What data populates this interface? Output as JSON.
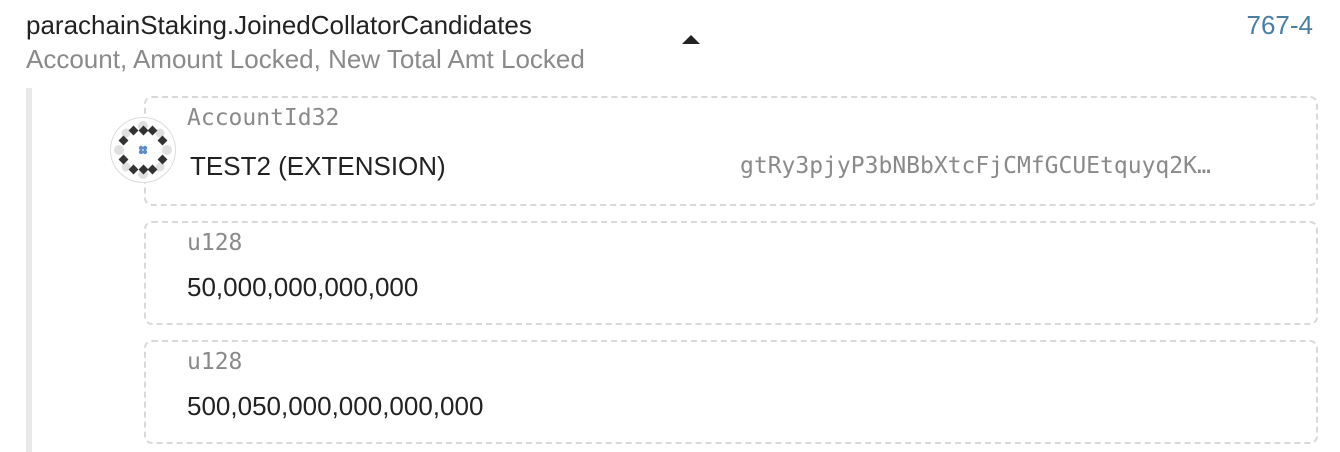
{
  "event": {
    "title": "parachainStaking.JoinedCollatorCandidates",
    "subtitle": "Account, Amount Locked, New Total Amt Locked",
    "index": "767-4",
    "toggle_icon": "caret-up-icon",
    "index_color": "#4a7fa5"
  },
  "params": {
    "account": {
      "type": "AccountId32",
      "name": "TEST2 (EXTENSION)",
      "address": "gtRy3pjyP3bNBbXtcFjCMfGCUEtquyq2K…",
      "icon": "identicon-icon"
    },
    "amount_locked": {
      "type": "u128",
      "value": "50,000,000,000,000"
    },
    "new_total_locked": {
      "type": "u128",
      "value": "500,050,000,000,000,000"
    }
  },
  "colors": {
    "text": "#222222",
    "muted": "#8a8a8a",
    "border": "#d9d9d9",
    "rail": "#e9e9e9"
  }
}
